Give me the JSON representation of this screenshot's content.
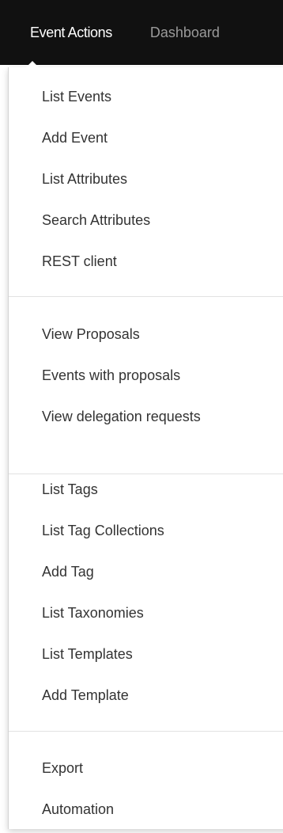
{
  "navbar": {
    "tabs": [
      {
        "label": "Event Actions"
      },
      {
        "label": "Dashboard"
      }
    ]
  },
  "menu": {
    "groups": [
      {
        "items": [
          "List Events",
          "Add Event",
          "List Attributes",
          "Search Attributes",
          "REST client"
        ]
      },
      {
        "items": [
          "View Proposals",
          "Events with proposals",
          "View delegation requests"
        ]
      },
      {
        "items": [
          "List Tags",
          "List Tag Collections",
          "Add Tag",
          "List Taxonomies",
          "List Templates",
          "Add Template"
        ]
      },
      {
        "items": [
          "Export",
          "Automation"
        ]
      }
    ]
  },
  "colors": {
    "navbar_bg": "#111111",
    "active_tab_text": "#ffffff",
    "inactive_tab_text": "#9a9a9a",
    "menu_text": "#333333",
    "divider": "#e2e2e2"
  }
}
